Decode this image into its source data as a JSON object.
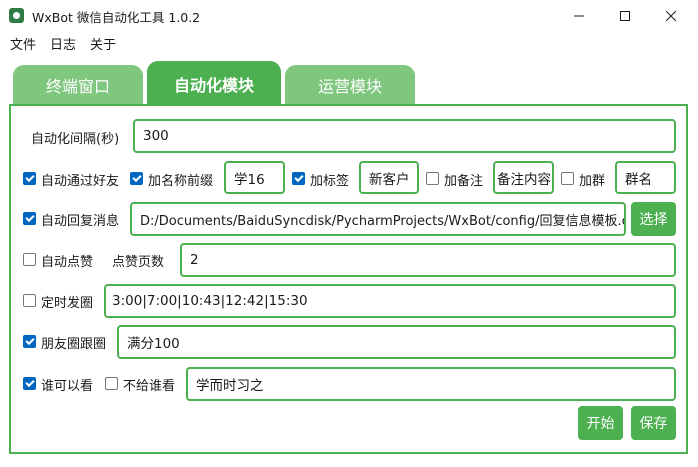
{
  "window": {
    "title": "WxBot 微信自动化工具 1.0.2",
    "minimize_icon": "minimize-icon",
    "maximize_icon": "maximize-icon",
    "close_icon": "close-icon"
  },
  "menu": {
    "file": "文件",
    "log": "日志",
    "about": "关于"
  },
  "tabs": [
    {
      "label": "终端窗口",
      "active": false
    },
    {
      "label": "自动化模块",
      "active": true
    },
    {
      "label": "运营模块",
      "active": false
    }
  ],
  "form": {
    "interval": {
      "label": "自动化间隔(秒)",
      "value": "300"
    },
    "auto_accept_friend": {
      "label": "自动通过好友",
      "checked": true
    },
    "add_name_prefix": {
      "label": "加名称前缀",
      "checked": true,
      "value": "学16"
    },
    "add_tag": {
      "label": "加标签",
      "checked": true,
      "value": "新客户"
    },
    "add_remark": {
      "label": "加备注",
      "checked": false,
      "value": "备注内容"
    },
    "add_group": {
      "label": "加群",
      "checked": false,
      "value": "群名"
    },
    "auto_reply": {
      "label": "自动回复消息",
      "checked": true,
      "value": "D:/Documents/BaiduSyncdisk/PycharmProjects/WxBot/config/回复信息模板.c",
      "button": "选择"
    },
    "auto_like": {
      "label": "自动点赞",
      "checked": false,
      "pages_label": "点赞页数",
      "pages_value": "2"
    },
    "scheduled_post": {
      "label": "定时发圈",
      "checked": false,
      "value": "3:00|7:00|10:43|12:42|15:30"
    },
    "moments_follow": {
      "label": "朋友圈跟圈",
      "checked": true,
      "value": "满分100"
    },
    "who_can_see": {
      "label": "谁可以看",
      "checked": true
    },
    "hide_from": {
      "label": "不给谁看",
      "checked": false,
      "value": "学而时习之"
    }
  },
  "actions": {
    "start": "开始",
    "save": "保存"
  },
  "colors": {
    "accent": "#4caf50",
    "tab_inactive": "#7fc67f",
    "checkbox": "#0067c0"
  }
}
